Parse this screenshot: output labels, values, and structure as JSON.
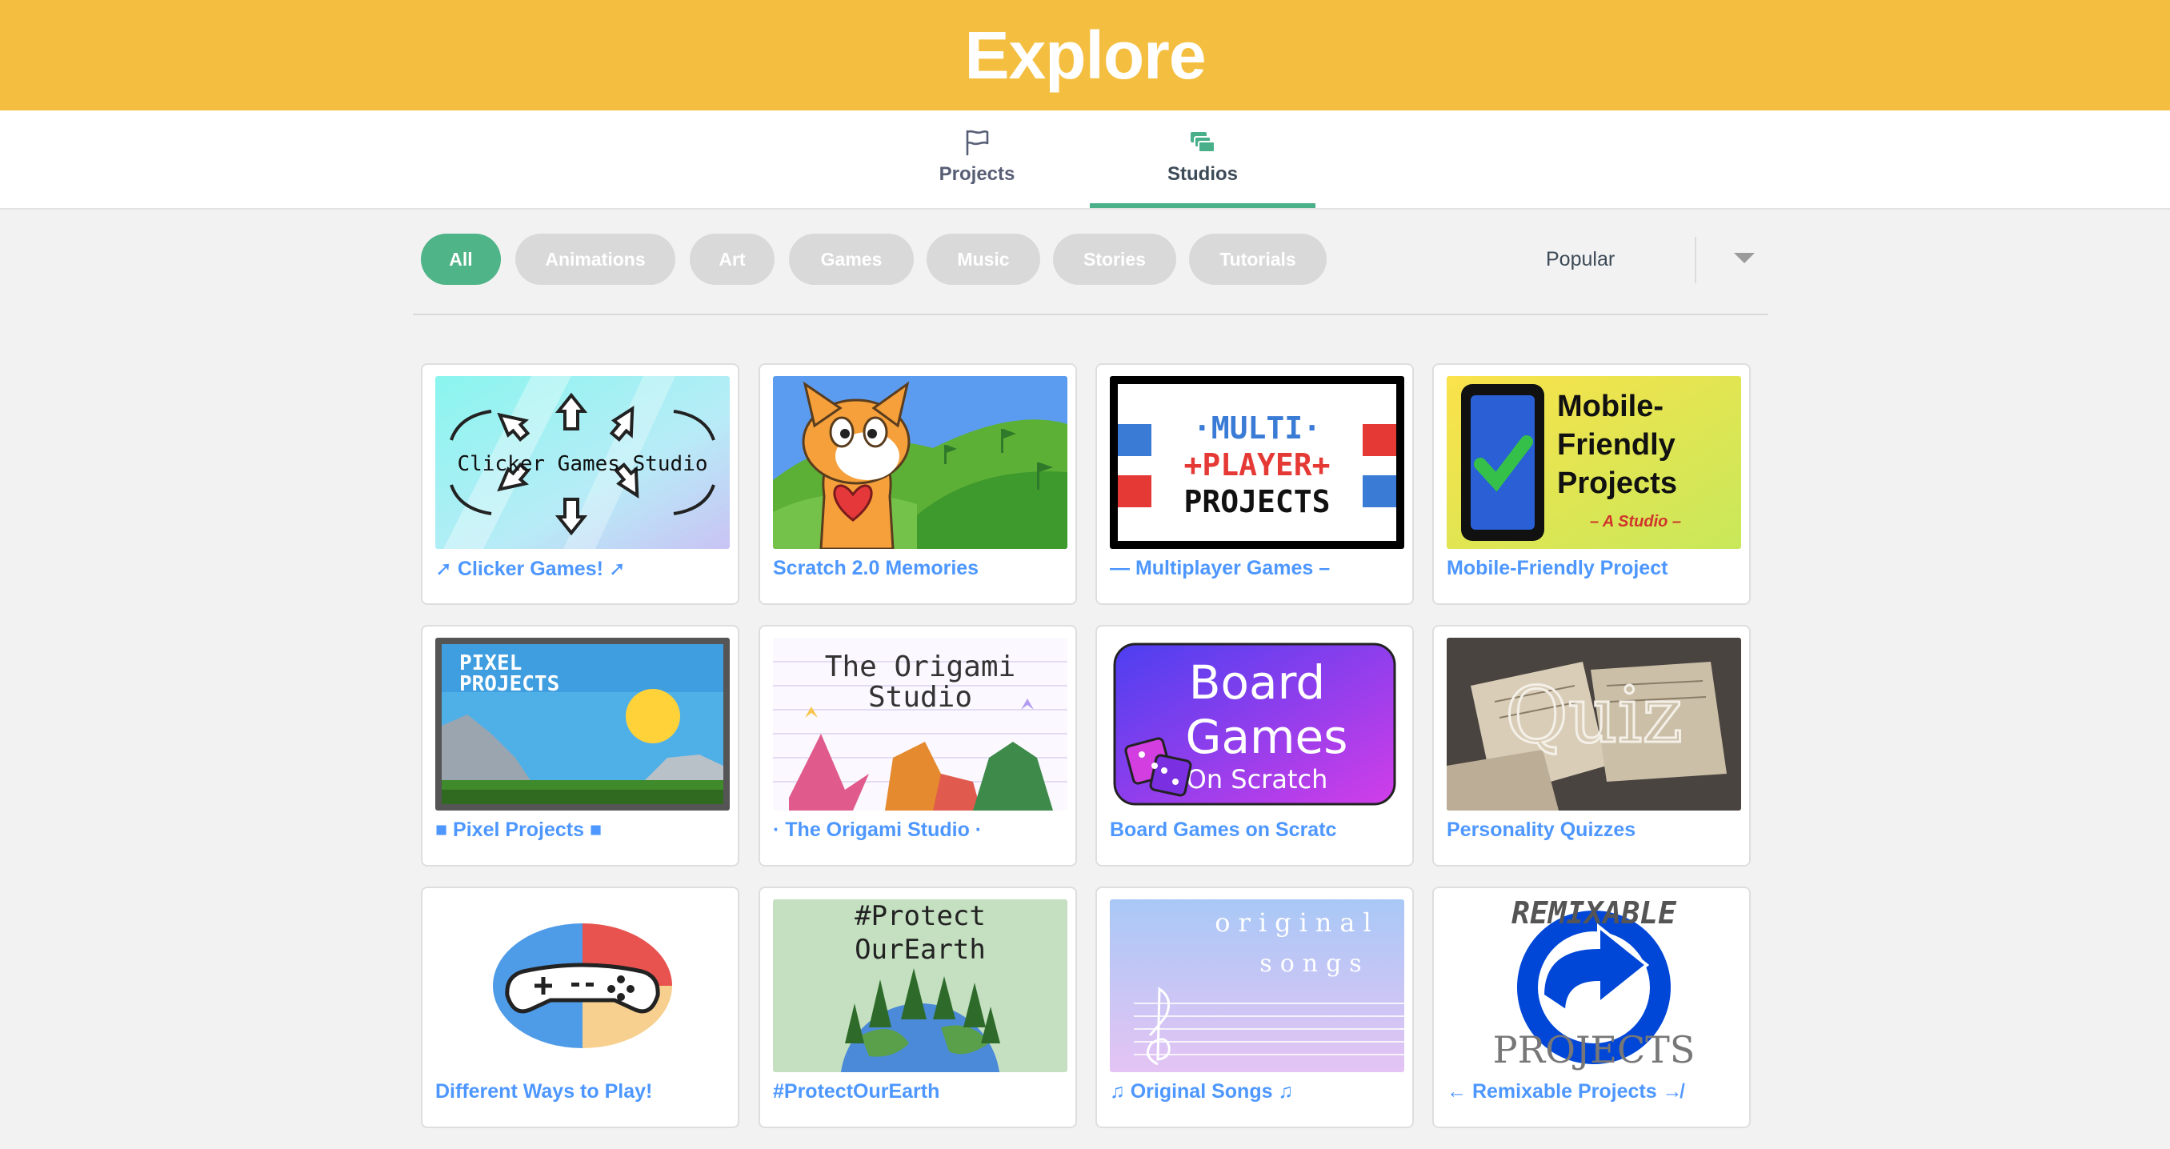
{
  "header": {
    "title": "Explore"
  },
  "tabs": [
    {
      "label": "Projects",
      "icon": "flag-icon",
      "active": false
    },
    {
      "label": "Studios",
      "icon": "studios-icon",
      "active": true
    }
  ],
  "filters": [
    "All",
    "Animations",
    "Art",
    "Games",
    "Music",
    "Stories",
    "Tutorials"
  ],
  "sort": {
    "selected": "Popular"
  },
  "colors": {
    "header": "#f4bf41",
    "accent": "#4fb487",
    "link": "#4d97ff"
  },
  "studios": [
    {
      "title": "➚ Clicker Games! ➚",
      "thumb_text": "Clicker Games Studio"
    },
    {
      "title": "Scratch 2.0 Memories"
    },
    {
      "title": "— Multiplayer Games –",
      "thumb_text": [
        "·MULTI·",
        "+PLAYER+",
        "PROJECTS"
      ]
    },
    {
      "title": "Mobile-Friendly Project",
      "thumb_text": [
        "Mobile-",
        "Friendly",
        "Projects",
        "– A Studio –"
      ]
    },
    {
      "title": "■ Pixel Projects ■",
      "thumb_text": [
        "PIXEL",
        "PROJECTS"
      ]
    },
    {
      "title": "· The Origami Studio ·",
      "thumb_text": [
        "The Origami",
        "Studio"
      ]
    },
    {
      "title": "Board Games on Scratc",
      "thumb_text": [
        "Board",
        "Games",
        "On Scratch"
      ]
    },
    {
      "title": "Personality Quizzes",
      "thumb_text": "Quiz"
    },
    {
      "title": "Different Ways to Play!"
    },
    {
      "title": "#ProtectOurEarth",
      "thumb_text": [
        "#Protect",
        "OurEarth"
      ]
    },
    {
      "title": "♫ Original Songs ♫",
      "thumb_text": [
        "original",
        "songs"
      ]
    },
    {
      "title": "← Remixable Projects ↛",
      "thumb_text": [
        "REMIXABLE",
        "PROJECTS"
      ]
    }
  ]
}
